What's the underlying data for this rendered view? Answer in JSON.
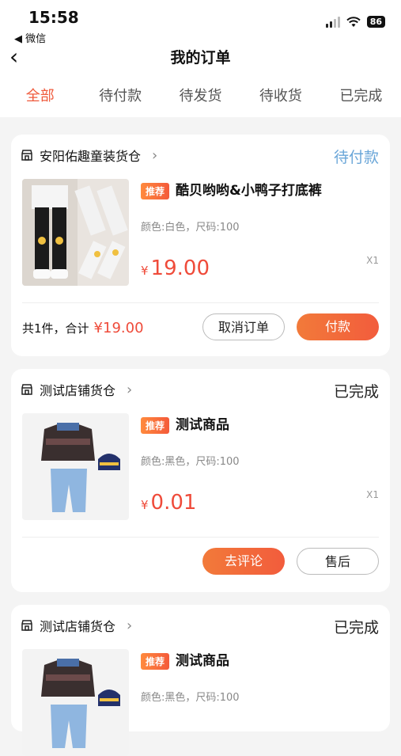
{
  "status_bar": {
    "time": "15:58",
    "back_app": "◀ 微信",
    "battery": "86"
  },
  "nav": {
    "title": "我的订单"
  },
  "tabs": [
    {
      "label": "全部",
      "active": true
    },
    {
      "label": "待付款"
    },
    {
      "label": "待发货"
    },
    {
      "label": "待收货"
    },
    {
      "label": "已完成"
    }
  ],
  "orders": [
    {
      "store": "安阳佑趣童装货仓",
      "status": "待付款",
      "badge": "推荐",
      "product": "酷贝哟哟&小鸭子打底裤",
      "spec": "颜色:白色，尺码:100",
      "price": "19.00",
      "qty": "X1",
      "total_label": "共1件，合计",
      "total": "¥19.00",
      "buttons": [
        "取消订单",
        "付款"
      ]
    },
    {
      "store": "测试店铺货仓",
      "status": "已完成",
      "badge": "推荐",
      "product": "测试商品",
      "spec": "颜色:黑色，尺码:100",
      "price": "0.01",
      "qty": "X1",
      "buttons": [
        "去评论",
        "售后"
      ]
    },
    {
      "store": "测试店铺货仓",
      "status": "已完成",
      "badge": "推荐",
      "product": "测试商品",
      "spec": "颜色:黑色，尺码:100"
    }
  ],
  "currency": "¥",
  "colors": {
    "accent": "#ef5a3c",
    "price": "#ef4b3a",
    "pay_status": "#6aa6d8"
  }
}
